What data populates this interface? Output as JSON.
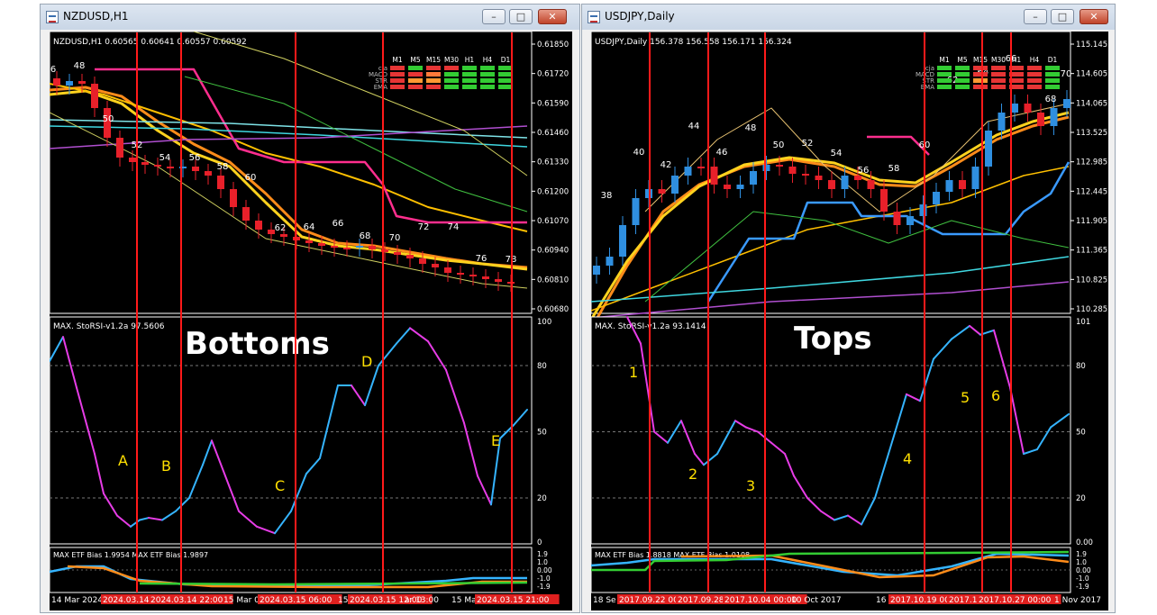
{
  "windows": [
    {
      "title": "NZDUSD,H1",
      "symbol_info": "NZDUSD,H1  0.60565 0.60641 0.60557 0.60592",
      "price_axis": [
        "0.61850",
        "0.61720",
        "0.61590",
        "0.61460",
        "0.61330",
        "0.61200",
        "0.61070",
        "0.60940",
        "0.60810",
        "0.60680"
      ],
      "candle_labels": [
        "6",
        "48",
        "50",
        "52",
        "54",
        "56",
        "58",
        "60",
        "62",
        "64",
        "66",
        "68",
        "70",
        "72",
        "74",
        "76",
        "78"
      ],
      "grid_rows": [
        "cja",
        "MACD",
        "STR",
        "EMA"
      ],
      "grid_cols": [
        "M1",
        "M5",
        "M15",
        "M30",
        "H1",
        "H4",
        "D1"
      ],
      "osc_label": "MAX. StoRSI-v1.2a 97.5606",
      "osc_axis": [
        "100",
        "80",
        "50",
        "20",
        "0"
      ],
      "osc_title": "Bottoms",
      "osc_markers": [
        "A",
        "B",
        "C",
        "D",
        "E"
      ],
      "etf_label": "MAX ETF Bias 1.9954  MAX ETF Bias 1.9897",
      "etf_axis": [
        "1.9",
        "1.0",
        "0.00",
        "-1.0",
        "-1.9"
      ],
      "time_axis": [
        "14 Mar 2024",
        "2024.03.14",
        "2024.03.14 22:00",
        "15 Mar 01",
        "2024.03.15 06:00",
        "15",
        "2024.03.15 12:00",
        "ar 13:00",
        "15 Ma",
        "2024.03.15 21:00"
      ]
    },
    {
      "title": "USDJPY,Daily",
      "symbol_info": "USDJPY,Daily  156.378 156.558 156.171 156.324",
      "price_axis": [
        "115.145",
        "114.605",
        "114.065",
        "113.525",
        "112.985",
        "112.445",
        "111.905",
        "111.365",
        "110.825",
        "110.285"
      ],
      "candle_labels": [
        "38",
        "40",
        "42",
        "44",
        "46",
        "48",
        "50",
        "52",
        "54",
        "56",
        "58",
        "60",
        "62",
        "64",
        "66",
        "68",
        "70"
      ],
      "grid_rows": [
        "cja",
        "MACD",
        "STR",
        "EMA"
      ],
      "grid_cols": [
        "M1",
        "M5",
        "M15",
        "M30",
        "H1",
        "H4",
        "D1"
      ],
      "osc_label": "MAX. StoRSI-v1.2a 93.1414",
      "osc_axis": [
        "101",
        "80",
        "50",
        "20",
        "0.00"
      ],
      "osc_title": "Tops",
      "osc_markers": [
        "1",
        "2",
        "3",
        "4",
        "5",
        "6"
      ],
      "etf_label": "MAX ETF Bias 1.8818  MAX ETF Bias 1.0108",
      "etf_axis": [
        "1.9",
        "1.0",
        "0.00",
        "-1.0",
        "-1.9"
      ],
      "time_axis": [
        "18 Se",
        "2017.09.22 00:00",
        "2017.09.28 00:00",
        "2017.10.04 00:00",
        "10 Oct 2017",
        "16",
        "2017.10.19 00:00",
        "2017.1",
        "2017.10.27 00:00",
        "1 Nov 2017"
      ]
    }
  ],
  "colors": {
    "chart_bg": "#000000",
    "bull": "#2f8fe0",
    "bear": "#e8202a",
    "vline": "#ff1a1a",
    "osc_up": "#35b4ff",
    "osc_down": "#e63ce6",
    "label_yellow": "#ffe000",
    "ma_orange": "#ff8c1a",
    "ma_yellow": "#ffd21e",
    "pink": "#ff2e8e",
    "cyan": "#3fd7e0"
  },
  "controls": {
    "minimize": "–",
    "maximize": "□",
    "close": "✕"
  }
}
